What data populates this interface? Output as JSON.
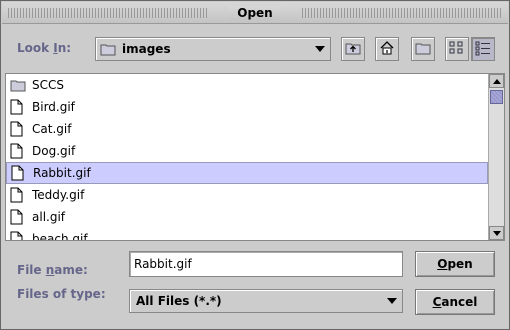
{
  "window": {
    "title": "Open"
  },
  "look_in": {
    "label_pre": "Look ",
    "label_u": "I",
    "label_post": "n:",
    "value": "images",
    "icon": "folder-icon"
  },
  "toolbar": [
    {
      "name": "up-one-level-button",
      "icon": "folder-up-icon"
    },
    {
      "name": "home-button",
      "icon": "home-icon"
    },
    {
      "name": "new-folder-button",
      "icon": "new-folder-icon"
    },
    {
      "name": "list-view-button",
      "icon": "list-view-icon"
    },
    {
      "name": "details-view-button",
      "icon": "details-view-icon"
    }
  ],
  "files": [
    {
      "name": "SCCS",
      "type": "folder"
    },
    {
      "name": "Bird.gif",
      "type": "file"
    },
    {
      "name": "Cat.gif",
      "type": "file"
    },
    {
      "name": "Dog.gif",
      "type": "file"
    },
    {
      "name": "Rabbit.gif",
      "type": "file",
      "selected": true
    },
    {
      "name": "Teddy.gif",
      "type": "file"
    },
    {
      "name": "all.gif",
      "type": "file"
    },
    {
      "name": "beach.gif",
      "type": "file"
    }
  ],
  "file_name": {
    "label_pre": "File ",
    "label_u": "n",
    "label_post": "ame:",
    "value": "Rabbit.gif"
  },
  "file_type": {
    "label": "Files of type:",
    "value": "All Files (*.*)"
  },
  "buttons": {
    "open_u": "O",
    "open_rest": "pen",
    "cancel_u": "C",
    "cancel_rest": "ancel"
  },
  "colors": {
    "accent": "#66668a",
    "selection": "#ccccff",
    "scroll_thumb": "#9999cc"
  }
}
